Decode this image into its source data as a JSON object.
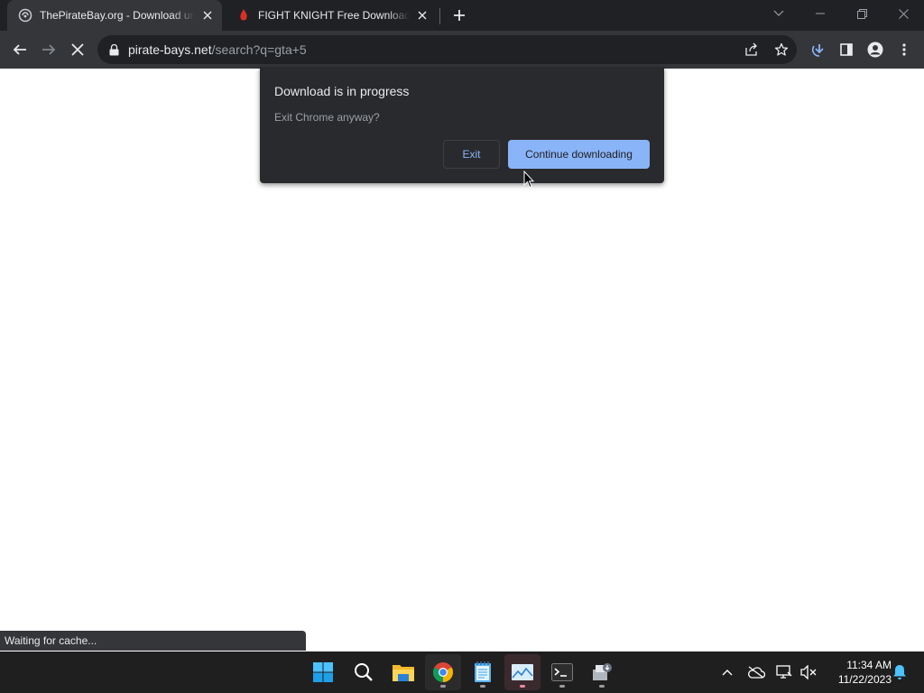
{
  "browser": {
    "tabs": [
      {
        "title": "ThePirateBay.org - Download unl",
        "favicon": "piratebay-favicon",
        "active": true
      },
      {
        "title": "FIGHT KNIGHT Free Download (v",
        "favicon": "red-favicon",
        "active": false
      }
    ],
    "url_domain": "pirate-bays.net",
    "url_path": "/search?q=gta+5"
  },
  "dialog": {
    "title": "Download is in progress",
    "message": "Exit Chrome anyway?",
    "exit_label": "Exit",
    "continue_label": "Continue downloading"
  },
  "status_bar": {
    "text": "Waiting for cache..."
  },
  "taskbar": {
    "apps": [
      "windows-start-icon",
      "search-icon",
      "file-explorer-icon",
      "chrome-icon",
      "notepad-icon",
      "photo-viewer-icon",
      "terminal-icon",
      "install-icon"
    ],
    "time": "11:34 AM",
    "date": "11/22/2023"
  },
  "colors": {
    "accent": "#8ab4f8",
    "titlebar": "#202124",
    "toolbar": "#35363a",
    "dialog_bg": "#292a2d",
    "taskbar": "#1f1f1f"
  }
}
